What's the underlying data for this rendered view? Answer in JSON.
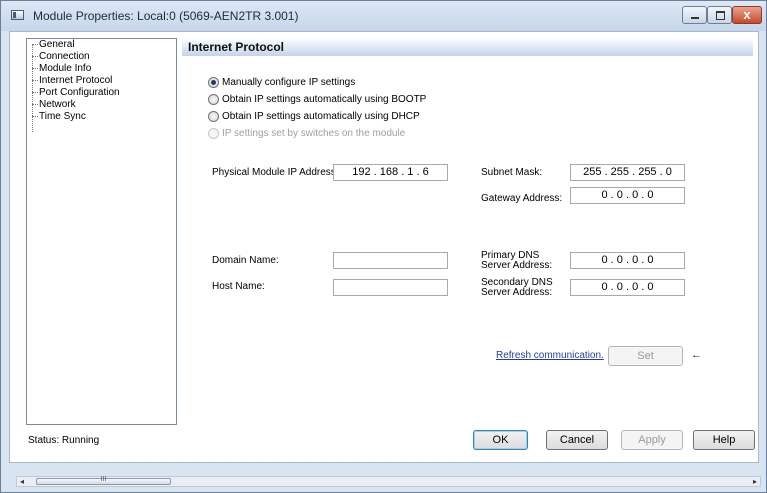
{
  "window": {
    "title": "Module Properties: Local:0 (5069-AEN2TR 3.001)",
    "close_glyph": "x"
  },
  "tree": {
    "items": [
      "General",
      "Connection",
      "Module Info",
      "Internet Protocol",
      "Port Configuration",
      "Network",
      "Time Sync"
    ]
  },
  "panel": {
    "title": "Internet Protocol"
  },
  "radios": [
    {
      "label": "Manually configure IP settings",
      "selected": true,
      "disabled": false
    },
    {
      "label": "Obtain IP settings automatically using BOOTP",
      "selected": false,
      "disabled": false
    },
    {
      "label": "Obtain IP settings automatically using DHCP",
      "selected": false,
      "disabled": false
    },
    {
      "label": "IP settings set by switches on the module",
      "selected": false,
      "disabled": true
    }
  ],
  "fields": {
    "ip_address_label": "Physical Module IP Address:",
    "ip_address_value": "192 . 168 . 1 . 6",
    "subnet_label": "Subnet Mask:",
    "subnet_value": "255 . 255 . 255 . 0",
    "gateway_label": "Gateway Address:",
    "gateway_value": "0 . 0 . 0 . 0",
    "domain_label": "Domain Name:",
    "domain_value": "",
    "host_label": "Host Name:",
    "host_value": "",
    "primary_dns_label": "Primary DNS Server Address:",
    "primary_dns_value": "0 . 0 . 0 . 0",
    "secondary_dns_label": "Secondary DNS Server Address:",
    "secondary_dns_value": "0 . 0 . 0 . 0"
  },
  "actions": {
    "refresh_link": "Refresh communication.",
    "set_label": "Set",
    "arrow_glyph": "←"
  },
  "footer": {
    "status": "Status:  Running",
    "ok": "OK",
    "cancel": "Cancel",
    "apply": "Apply",
    "help": "Help"
  },
  "scrollbar": {
    "left_glyph": "◂",
    "right_glyph": "▸",
    "grip": "III"
  }
}
